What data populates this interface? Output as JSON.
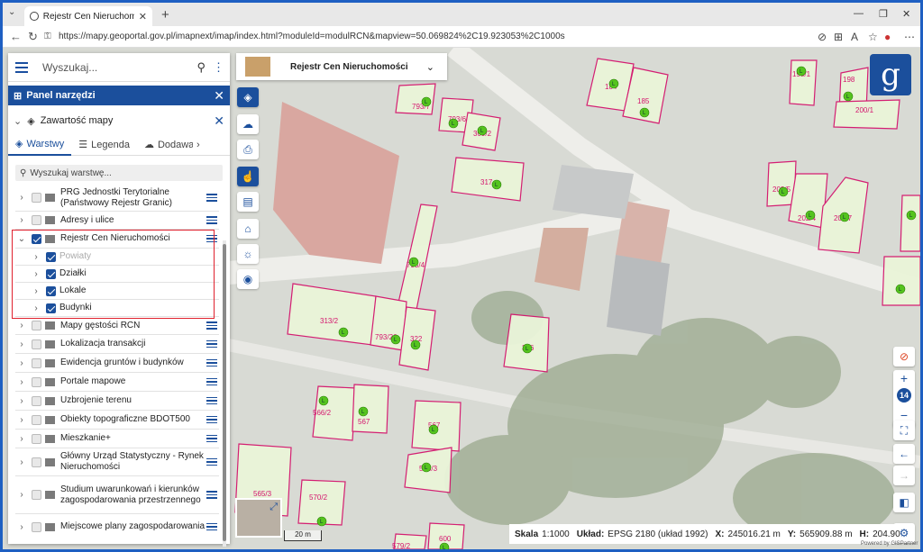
{
  "browser": {
    "tab_title": "Rejestr Cen Nieruchomości - Geop",
    "url": "https://mapy.geoportal.gov.pl/imapnext/imap/index.html?moduleId=modulRCN&mapview=50.069824%2C19.923053%2C1000s"
  },
  "panel": {
    "search_placeholder": "Wyszukaj...",
    "tools_title": "Panel narzędzi",
    "content_title": "Zawartość mapy",
    "tabs": [
      "Warstwy",
      "Legenda",
      "Dodawanie"
    ],
    "layer_search_placeholder": "Wyszukaj warstwę...",
    "layers": [
      {
        "label": "PRG Jednostki Terytorialne (Państwowy Rejestr Granic)",
        "checked": false
      },
      {
        "label": "Adresy i ulice",
        "checked": false
      },
      {
        "label": "Rejestr Cen Nieruchomości",
        "checked": true
      },
      {
        "label": "Powiaty",
        "checked": true
      },
      {
        "label": "Działki",
        "checked": true
      },
      {
        "label": "Lokale",
        "checked": true
      },
      {
        "label": "Budynki",
        "checked": true
      },
      {
        "label": "Mapy gęstości RCN",
        "checked": false
      },
      {
        "label": "Lokalizacja transakcji",
        "checked": false
      },
      {
        "label": "Ewidencja gruntów i budynków",
        "checked": false
      },
      {
        "label": "Portale mapowe",
        "checked": false
      },
      {
        "label": "Uzbrojenie terenu",
        "checked": false
      },
      {
        "label": "Obiekty topograficzne BDOT500",
        "checked": false
      },
      {
        "label": "Mieszkanie+",
        "checked": false
      },
      {
        "label": "Główny Urząd Statystyczny - Rynek Nieruchomości",
        "checked": false
      },
      {
        "label": "Studium uwarunkowań i kierunków zagospodarowania przestrzennego",
        "checked": false
      },
      {
        "label": "Miejscowe plany zagospodarowania",
        "checked": false
      }
    ]
  },
  "map": {
    "module_title": "Rejestr Cen Nieruchomości",
    "logo_letter": "g",
    "zoom_level": "14",
    "scale_bar": "20 m",
    "status": {
      "scale_label": "Skala",
      "scale_value": "1:1000",
      "crs_label": "Układ:",
      "crs_value": "EPSG 2180 (układ 1992)",
      "x_label": "X:",
      "x_value": "245016.21 m",
      "y_label": "Y:",
      "y_value": "565909.88 m",
      "h_label": "H:",
      "h_value": "204.90"
    },
    "powered_by": "Powered by GISPartner",
    "parcel_labels": [
      "184",
      "185",
      "198/1",
      "198",
      "200/1",
      "793/7",
      "793/6",
      "309/2",
      "317",
      "202/5",
      "202/4",
      "202/7",
      "793/4",
      "313/2",
      "793/26",
      "322",
      "316",
      "566/2",
      "567",
      "567",
      "566/3",
      "565/3",
      "570/2",
      "600",
      "579/2"
    ],
    "marker_letter": "L"
  },
  "colors": {
    "accent": "#1b4f9c",
    "parcel": "#d4146d",
    "marker": "#55c41e",
    "highlight": "#e0202d"
  }
}
